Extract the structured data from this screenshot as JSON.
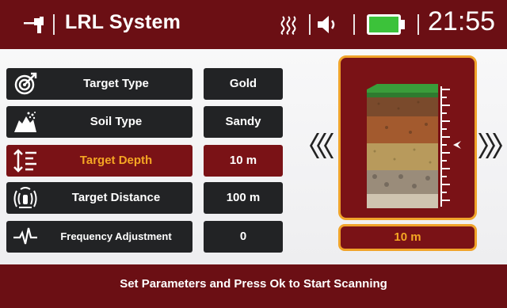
{
  "header": {
    "title": "LRL System",
    "time": "21:55",
    "battery_color": "#3cc23a",
    "icons": [
      "detector-icon",
      "heat-signal-icon",
      "volume-icon",
      "battery-icon"
    ]
  },
  "parameters": [
    {
      "label": "Target Type",
      "value": "Gold",
      "icon": "target-icon",
      "active": false
    },
    {
      "label": "Soil Type",
      "value": "Sandy",
      "icon": "soil-icon",
      "active": false
    },
    {
      "label": "Target Depth",
      "value": "10 m",
      "icon": "depth-icon",
      "active": true
    },
    {
      "label": "Target Distance",
      "value": "100 m",
      "icon": "signal-range-icon",
      "active": false
    },
    {
      "label": "Frequency Adjustment",
      "value": "0",
      "icon": "frequency-icon",
      "active": false
    }
  ],
  "depth_display": "10 m",
  "footer_text": "Set Parameters and Press Ok to Start Scanning",
  "colors": {
    "brand": "#6b0f14",
    "active": "#7a1216",
    "accent": "#f5a623",
    "button": "#222325"
  }
}
